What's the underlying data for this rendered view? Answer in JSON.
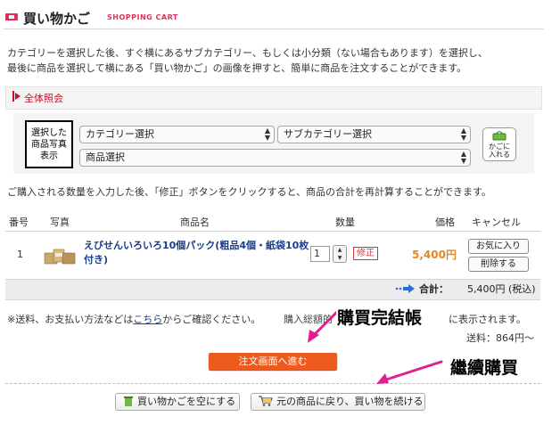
{
  "header": {
    "title": "買い物かご",
    "subtitle": "SHOPPING CART"
  },
  "intro": {
    "line1": "カテゴリーを選択した後、すぐ横にあるサブカテゴリー、もしくは小分類（ない場合もあります）を選択し、",
    "line2": "最後に商品を選択して横にある「買い物かご」の画像を押すと、簡単に商品を注文することができます。"
  },
  "catalog": {
    "label": "全体照会",
    "thumb_lines": [
      "選択した",
      "商品写真",
      "表示"
    ],
    "category_select": "カテゴリー選択",
    "subcategory_select": "サブカテゴリー選択",
    "product_select": "商品選択",
    "cart_button_lines": [
      "かごに",
      "入れる"
    ]
  },
  "qty_note": "ご購入される数量を入力した後、「修正」ボタンをクリックすると、商品の合計を再計算することができます。",
  "table": {
    "headers": {
      "no": "番号",
      "photo": "写真",
      "name": "商品名",
      "qty": "数量",
      "price": "価格",
      "cancel": "キャンセル"
    },
    "rows": [
      {
        "no": "1",
        "name": "えびせんいろいろ10個パック(粗品4個・紙袋10枚付き)",
        "qty": "1",
        "fix": "修正",
        "price": "5,400円",
        "fav": "お気に入り",
        "delete": "削除する"
      }
    ],
    "total_label": "合計：",
    "total_value": "5,400円 (税込)"
  },
  "shipping_note": {
    "pre": "※送料、お支払い方法などは",
    "link": "こちら",
    "post": "からご確認ください。",
    "tail_pre": "購入総額的",
    "tail": "に表示されます。"
  },
  "shipping_fee": "送料：864円〜",
  "buttons": {
    "order": "注文画面へ進む",
    "empty": "買い物かごを空にする",
    "continue": "元の商品に戻り、買い物を続ける"
  },
  "annotations": {
    "checkout": "購買完結帳",
    "continue": "繼續購買"
  },
  "colors": {
    "accent": "#e0305a",
    "price": "#e8861e",
    "order_button": "#ee5a1e",
    "link": "#1a3d8f"
  }
}
